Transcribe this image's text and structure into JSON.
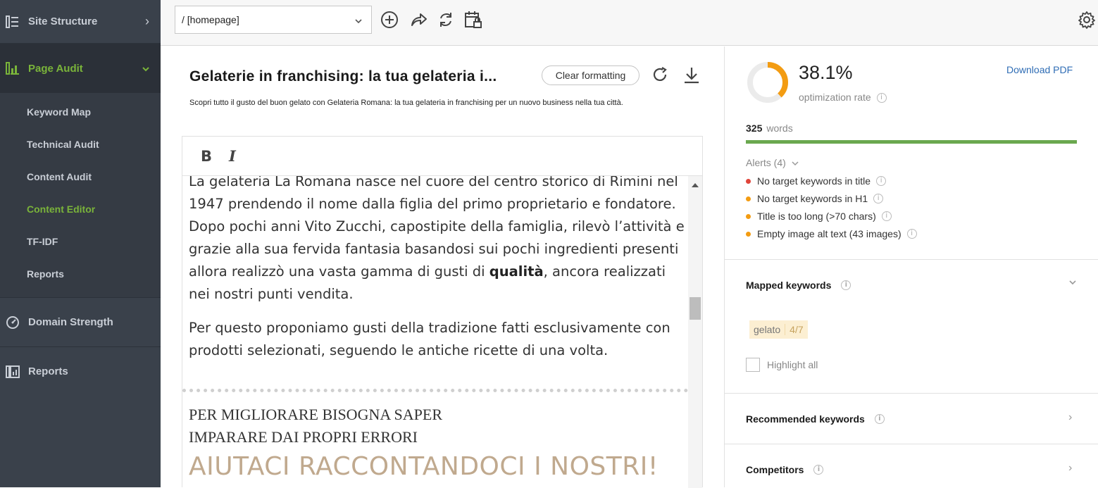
{
  "sidebar": {
    "site_structure": "Site Structure",
    "page_audit": "Page Audit",
    "subnav": [
      "Keyword Map",
      "Technical Audit",
      "Content Audit",
      "Content Editor",
      "TF-IDF",
      "Reports"
    ],
    "active_subitem": "Content Editor",
    "domain_strength": "Domain Strength",
    "reports": "Reports"
  },
  "toolbar": {
    "page_select_value": "/ [homepage]"
  },
  "editor": {
    "title": "Gelaterie in franchising: la tua gelateria i...",
    "clear_formatting": "Clear formatting",
    "description": "Scopri tutto il gusto del buon gelato con Gelateria Romana: la tua gelateria in franchising per un nuovo business nella tua città.",
    "bold_label": "B",
    "italic_label": "I",
    "p1_before": "La gelateria La Romana nasce nel cuore del centro storico di Rimini nel 1947 prendendo il nome dalla figlia del primo proprietario e fondatore. Dopo pochi anni Vito Zucchi, capostipite della famiglia, rilevò l’attività e grazie alla sua fervida fantasia basandosi sui pochi ingredienti presenti allora realizzò una vasta gamma di gusti di ",
    "p1_bold": "qualità",
    "p1_after": ", ancora realizzati nei nostri punti vendita.",
    "p2": "Per questo proponiamo gusti della tradizione fatti esclusivamente con prodotti selezionati, seguendo le antiche ricette di una volta.",
    "serif_line1": "PER MIGLIORARE BISOGNA SAPER",
    "serif_line2": "IMPARARE DAI PROPRI ERRORI",
    "big_heading": "AIUTACI RACCONTANDOCI I NOSTRI!"
  },
  "right_panel": {
    "optimization_rate": "38.1%",
    "optimization_fraction": 0.381,
    "optimization_label": "optimization rate",
    "download_pdf": "Download PDF",
    "word_count": "325",
    "words_label": "words",
    "alerts_header": "Alerts (4)",
    "alerts": [
      {
        "text": "No target keywords in title",
        "color": "#e0443a"
      },
      {
        "text": "No target keywords in H1",
        "color": "#f39c12"
      },
      {
        "text": "Title is too long (>70 chars)",
        "color": "#f39c12"
      },
      {
        "text": "Empty image alt text (43 images)",
        "color": "#f39c12"
      }
    ],
    "mapped_keywords_title": "Mapped keywords",
    "keyword_tag": "gelato",
    "keyword_count": "4/7",
    "highlight_all": "Highlight all",
    "recommended_title": "Recommended keywords",
    "competitors_title": "Competitors"
  },
  "colors": {
    "accent_green": "#7ab43a",
    "donut_orange": "#f39c12",
    "words_bar": "#6aa84f",
    "link_blue": "#2f6db5"
  }
}
